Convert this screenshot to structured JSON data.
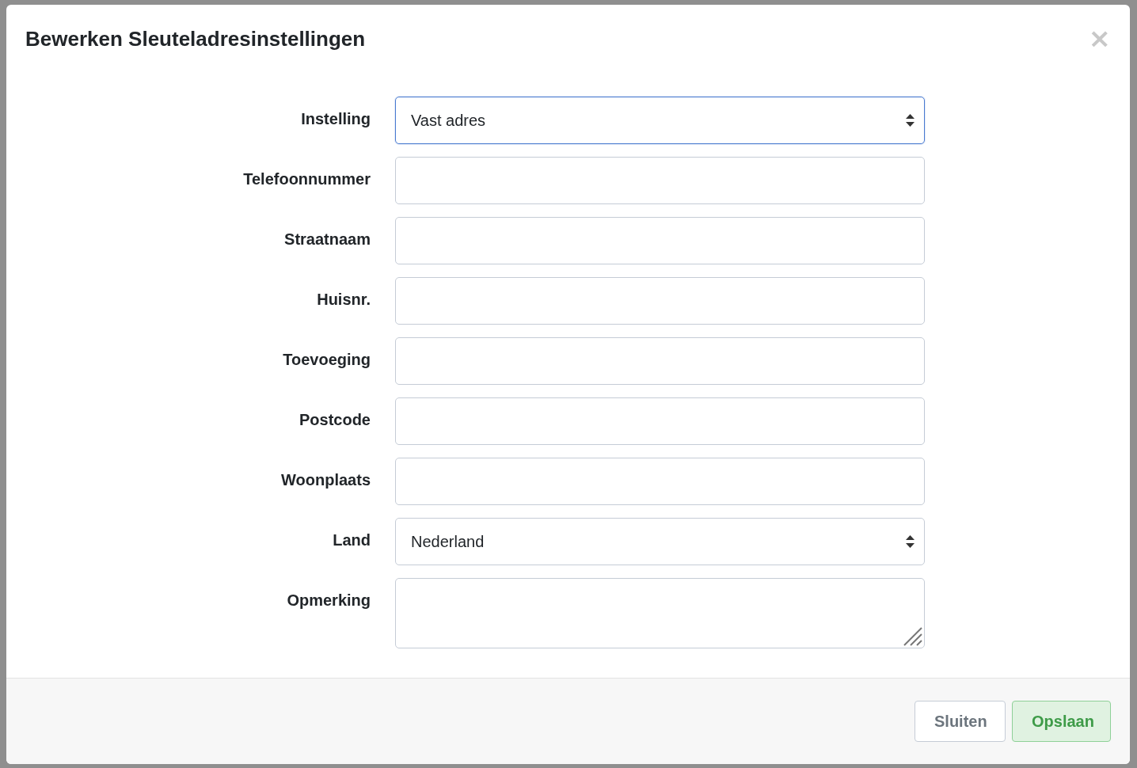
{
  "dialog": {
    "title": "Bewerken Sleuteladresinstellingen",
    "close": "×"
  },
  "fields": [
    {
      "label": "Instelling",
      "kind": "select",
      "value": "Vast adres",
      "focused": true
    },
    {
      "label": "Telefoonnummer",
      "kind": "text",
      "focused": false
    },
    {
      "label": "Straatnaam",
      "kind": "text",
      "focused": false
    },
    {
      "label": "Huisnr.",
      "kind": "text",
      "focused": false
    },
    {
      "label": "Toevoeging",
      "kind": "text",
      "focused": false
    },
    {
      "label": "Postcode",
      "kind": "text",
      "focused": false
    },
    {
      "label": "Woonplaats",
      "kind": "text",
      "focused": false
    },
    {
      "label": "Land",
      "kind": "select",
      "value": "Nederland",
      "focused": false
    },
    {
      "label": "Opmerking",
      "kind": "textarea",
      "focused": false
    }
  ],
  "buttons": [
    {
      "label": "Sluiten",
      "kind": "default"
    },
    {
      "label": "Opslaan",
      "kind": "primary"
    }
  ]
}
